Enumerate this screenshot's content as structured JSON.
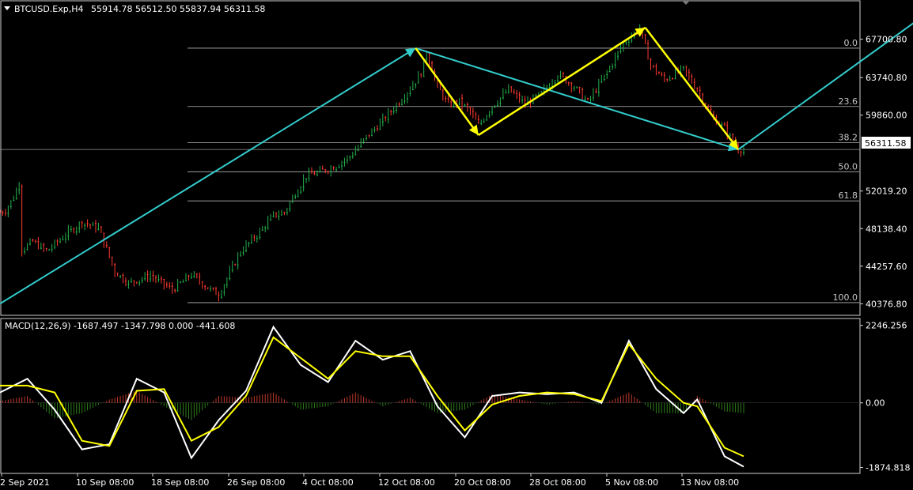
{
  "header": {
    "symbol": "BTCUSD.Exp,H4",
    "ohlc": "55914.78 56512.50 55837.94 56311.58"
  },
  "macd_header": {
    "label": "MACD(12,26,9) -1687.497 -1347.798 0.000 -441.608"
  },
  "price_badge": "56311.58",
  "colors": {
    "background": "#000000",
    "bull_candle": "#22b14c",
    "bear_candle": "#ff3b30",
    "macd_line": "#ffffff",
    "signal_line": "#ffff00",
    "hist_pos": "#c0392b",
    "hist_neg": "#2e7d1a",
    "trend_arrow": "#33cccc",
    "wave_arrow": "#ffff00",
    "fib_line": "#b4b4b4"
  },
  "chart_data": [
    {
      "type": "candlestick",
      "title": "",
      "timeframe": "H4",
      "y_axis": {
        "ticks": [
          "67700.80",
          "63740.80",
          "59860.00",
          "56311.58",
          "52019.20",
          "48138.40",
          "44257.60",
          "40376.80"
        ],
        "range": [
          39750,
          71100
        ]
      },
      "x_axis": {
        "ticks": [
          "2 Sep 2021",
          "10 Sep 08:00",
          "18 Sep 08:00",
          "26 Sep 08:00",
          "4 Oct 08:00",
          "12 Oct 08:00",
          "20 Oct 08:00",
          "28 Oct 08:00",
          "5 Nov 08:00",
          "13 Nov 08:00"
        ]
      },
      "close_path": [
        [
          0,
          49800
        ],
        [
          2,
          50000
        ],
        [
          5,
          51400
        ],
        [
          7,
          52800
        ],
        [
          8,
          46000
        ],
        [
          12,
          46800
        ],
        [
          17,
          45800
        ],
        [
          24,
          47500
        ],
        [
          30,
          48800
        ],
        [
          36,
          48200
        ],
        [
          42,
          43700
        ],
        [
          47,
          42500
        ],
        [
          55,
          43300
        ],
        [
          63,
          41800
        ],
        [
          70,
          43400
        ],
        [
          75,
          42200
        ],
        [
          80,
          41300
        ],
        [
          88,
          45800
        ],
        [
          95,
          47800
        ],
        [
          100,
          49500
        ],
        [
          104,
          49800
        ],
        [
          108,
          51800
        ],
        [
          112,
          53600
        ],
        [
          116,
          53900
        ],
        [
          122,
          54500
        ],
        [
          128,
          55600
        ],
        [
          134,
          57600
        ],
        [
          140,
          59300
        ],
        [
          148,
          61900
        ],
        [
          154,
          64200
        ],
        [
          156,
          66400
        ],
        [
          160,
          62800
        ],
        [
          164,
          60900
        ],
        [
          168,
          61300
        ],
        [
          172,
          60200
        ],
        [
          175,
          58800
        ],
        [
          180,
          60800
        ],
        [
          186,
          62500
        ],
        [
          192,
          61000
        ],
        [
          198,
          62100
        ],
        [
          204,
          64100
        ],
        [
          210,
          62800
        ],
        [
          215,
          61200
        ],
        [
          222,
          64300
        ],
        [
          228,
          67300
        ],
        [
          234,
          68800
        ],
        [
          238,
          65000
        ],
        [
          243,
          63500
        ],
        [
          250,
          64600
        ],
        [
          255,
          62500
        ],
        [
          260,
          59800
        ],
        [
          265,
          58500
        ],
        [
          270,
          56311.58
        ]
      ],
      "fibonacci": {
        "levels": [
          {
            "label": "0.0",
            "price": 66780
          },
          {
            "label": "23.6",
            "price": 60750
          },
          {
            "label": "38.2",
            "price": 57020
          },
          {
            "label": "50.0",
            "price": 54010
          },
          {
            "label": "61.8",
            "price": 51000
          },
          {
            "label": "100.0",
            "price": 40490
          }
        ]
      },
      "annotations": {
        "trend_arrows": [
          {
            "from": [
              0,
              40380
            ],
            "to": [
              152,
              66780
            ]
          },
          {
            "from": [
              152,
              66780
            ],
            "to": [
              270,
              56311
            ]
          },
          {
            "from": [
              270,
              56311
            ],
            "to": [
              347,
              72000
            ]
          }
        ],
        "wave_arrows": [
          {
            "from": [
              152,
              66780
            ],
            "to": [
              175,
              57800
            ]
          },
          {
            "from": [
              175,
              57800
            ],
            "to": [
              236,
              68900
            ]
          },
          {
            "from": [
              236,
              68900
            ],
            "to": [
              270,
              56311
            ]
          }
        ]
      }
    },
    {
      "type": "line",
      "title": "",
      "indicator": "MACD(12,26,9)",
      "y_axis": {
        "ticks": [
          "2246.256",
          "0.00",
          "-1874.818"
        ],
        "range": [
          -2000,
          2400
        ]
      },
      "series": [
        {
          "color": "#ffffff",
          "points": [
            [
              0,
              300
            ],
            [
              10,
              700
            ],
            [
              20,
              -200
            ],
            [
              30,
              -1350
            ],
            [
              40,
              -1200
            ],
            [
              50,
              700
            ],
            [
              60,
              300
            ],
            [
              70,
              -1600
            ],
            [
              80,
              -500
            ],
            [
              90,
              350
            ],
            [
              100,
              2200
            ],
            [
              110,
              1100
            ],
            [
              120,
              600
            ],
            [
              130,
              1800
            ],
            [
              140,
              1250
            ],
            [
              150,
              1500
            ],
            [
              160,
              -100
            ],
            [
              170,
              -1000
            ],
            [
              180,
              200
            ],
            [
              190,
              300
            ],
            [
              200,
              250
            ],
            [
              210,
              300
            ],
            [
              220,
              0
            ],
            [
              230,
              1800
            ],
            [
              240,
              400
            ],
            [
              250,
              -300
            ],
            [
              255,
              100
            ],
            [
              265,
              -1550
            ],
            [
              272,
              -1850
            ]
          ]
        },
        {
          "color": "#ffff00",
          "points": [
            [
              0,
              500
            ],
            [
              10,
              500
            ],
            [
              20,
              300
            ],
            [
              30,
              -1100
            ],
            [
              40,
              -1250
            ],
            [
              50,
              350
            ],
            [
              60,
              400
            ],
            [
              70,
              -1100
            ],
            [
              80,
              -700
            ],
            [
              90,
              200
            ],
            [
              100,
              1900
            ],
            [
              110,
              1300
            ],
            [
              120,
              700
            ],
            [
              130,
              1500
            ],
            [
              140,
              1350
            ],
            [
              150,
              1350
            ],
            [
              160,
              200
            ],
            [
              170,
              -800
            ],
            [
              180,
              -50
            ],
            [
              190,
              200
            ],
            [
              200,
              300
            ],
            [
              210,
              250
            ],
            [
              220,
              50
            ],
            [
              230,
              1700
            ],
            [
              240,
              700
            ],
            [
              250,
              0
            ],
            [
              255,
              -100
            ],
            [
              265,
              -1300
            ],
            [
              272,
              -1550
            ]
          ]
        }
      ],
      "histogram": [
        [
          0,
          50
        ],
        [
          10,
          200
        ],
        [
          20,
          -450
        ],
        [
          30,
          -300
        ],
        [
          40,
          100
        ],
        [
          50,
          350
        ],
        [
          60,
          -100
        ],
        [
          70,
          -500
        ],
        [
          80,
          200
        ],
        [
          90,
          150
        ],
        [
          100,
          300
        ],
        [
          110,
          -200
        ],
        [
          120,
          -100
        ],
        [
          130,
          300
        ],
        [
          140,
          -100
        ],
        [
          150,
          150
        ],
        [
          160,
          -300
        ],
        [
          170,
          -200
        ],
        [
          180,
          250
        ],
        [
          190,
          100
        ],
        [
          200,
          -50
        ],
        [
          210,
          50
        ],
        [
          220,
          -50
        ],
        [
          230,
          300
        ],
        [
          240,
          -300
        ],
        [
          250,
          -300
        ],
        [
          255,
          200
        ],
        [
          265,
          -250
        ],
        [
          272,
          -300
        ]
      ]
    }
  ]
}
